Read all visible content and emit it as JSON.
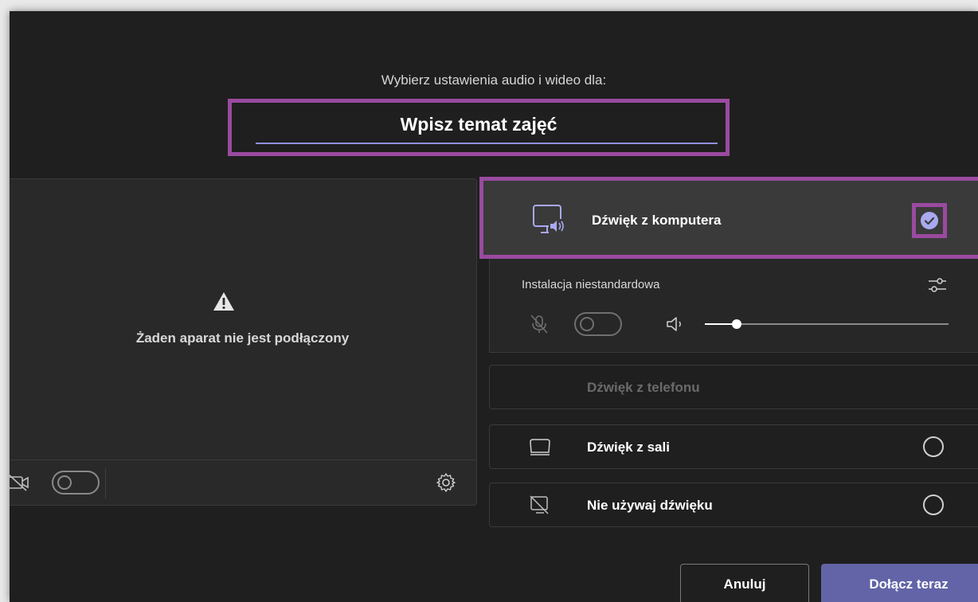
{
  "header": {
    "subtitle": "Wybierz ustawienia audio i wideo dla:",
    "meeting_title": "Wpisz temat zajęć"
  },
  "video": {
    "no_camera_text": "Żaden aparat nie jest podłączony",
    "camera_toggle_on": false
  },
  "audio_options": {
    "computer": {
      "label": "Dźwięk z komputera",
      "selected": true
    },
    "custom": {
      "label": "Instalacja niestandardowa",
      "mic_toggle_on": false,
      "volume_fraction": 0.13
    },
    "phone": {
      "label": "Dźwięk z telefonu",
      "enabled": false
    },
    "room": {
      "label": "Dźwięk z sali",
      "selected": false
    },
    "none": {
      "label": "Nie używaj dźwięku",
      "selected": false
    }
  },
  "actions": {
    "cancel_label": "Anuluj",
    "join_label": "Dołącz teraz"
  },
  "colors": {
    "background": "#1f1f1f",
    "accent": "#6264a7",
    "highlight_border": "#9a4aa0",
    "check": "#a9a9f0"
  }
}
